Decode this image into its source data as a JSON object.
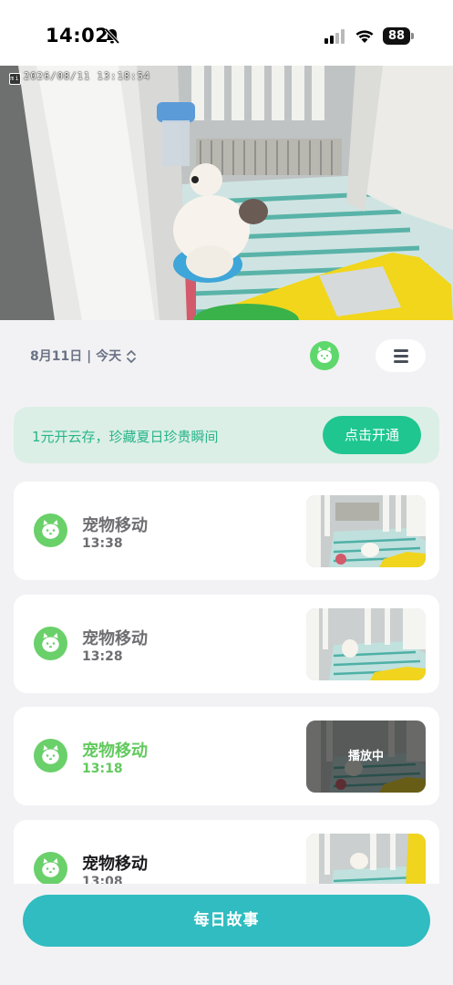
{
  "status_bar": {
    "time": "14:02",
    "battery": "88"
  },
  "camera": {
    "timestamp": "2026/08/11  13:18:54",
    "logo": "mi"
  },
  "toolbar": {
    "date_label": "8月11日 | 今天"
  },
  "promo": {
    "text": "1元开云存，珍藏夏日珍贵瞬间",
    "button": "点击开通"
  },
  "events": [
    {
      "title": "宠物移动",
      "time": "13:38",
      "overlay": ""
    },
    {
      "title": "宠物移动",
      "time": "13:28",
      "overlay": ""
    },
    {
      "title": "宠物移动",
      "time": "13:18",
      "overlay": "播放中"
    },
    {
      "title": "宠物移动",
      "time": "13:08",
      "overlay": ""
    }
  ],
  "footer": {
    "daily_story": "每日故事"
  },
  "colors": {
    "accent_green": "#62c95e",
    "promo_button": "#1fc690",
    "footer_button": "#30bcc0"
  }
}
